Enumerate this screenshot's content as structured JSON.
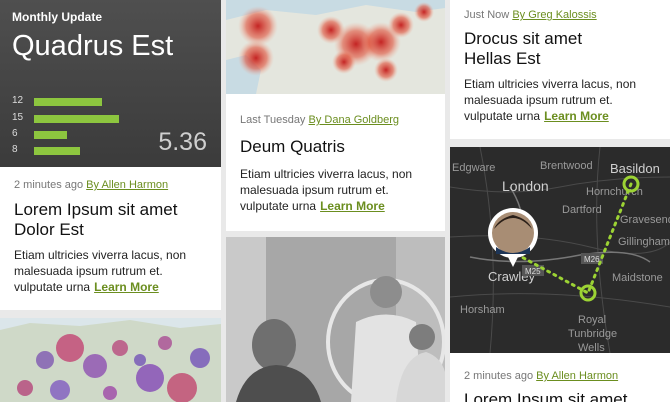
{
  "stats_card": {
    "label": "Monthly Update",
    "title": "Quadrus Est",
    "rows": [
      {
        "num": "12",
        "level": 0.59
      },
      {
        "num": "15",
        "level": 0.74
      },
      {
        "num": "6",
        "level": 0.29
      },
      {
        "num": "8",
        "level": 0.4
      }
    ],
    "value": "5.36",
    "accent": "#8dc63f"
  },
  "cards": [
    {
      "meta_time": "2 minutes ago",
      "author": "By Allen Harmon",
      "title_line1": "Lorem Ipsum sit amet",
      "title_line2": "Dolor Est",
      "body": "Etiam ultricies viverra lacus, non malesuada ipsum rutrum et. vulputate urna",
      "link": "Learn More"
    },
    {
      "meta_time": "Last Tuesday",
      "author": "By Dana Goldberg",
      "title_line1": "Deum Quatris",
      "body": "Etiam ultricies viverra lacus, non malesuada ipsum rutrum et. vulputate urna",
      "link": "Learn More"
    },
    {
      "meta_time": "Just Now",
      "author": "By Greg Kalossis",
      "title_line1": "Drocus sit amet",
      "title_line2": "Hellas Est",
      "body": "Etiam ultricies viverra lacus, non malesuada ipsum rutrum et. vulputate urna",
      "link": "Learn More"
    },
    {
      "meta_time": "2 minutes ago",
      "author": "By Allen Harmon",
      "title_line1": "Lorem Ipsum sit amet"
    }
  ],
  "map": {
    "places": [
      "Edgware",
      "Brentwood",
      "Basildon",
      "London",
      "Hornchurch",
      "Dartford",
      "Gravesend",
      "Gillingham",
      "Maidstone",
      "Crawley",
      "Royal",
      "Tunbridge",
      "Wells",
      "Horsham",
      "M25",
      "M26"
    ]
  }
}
